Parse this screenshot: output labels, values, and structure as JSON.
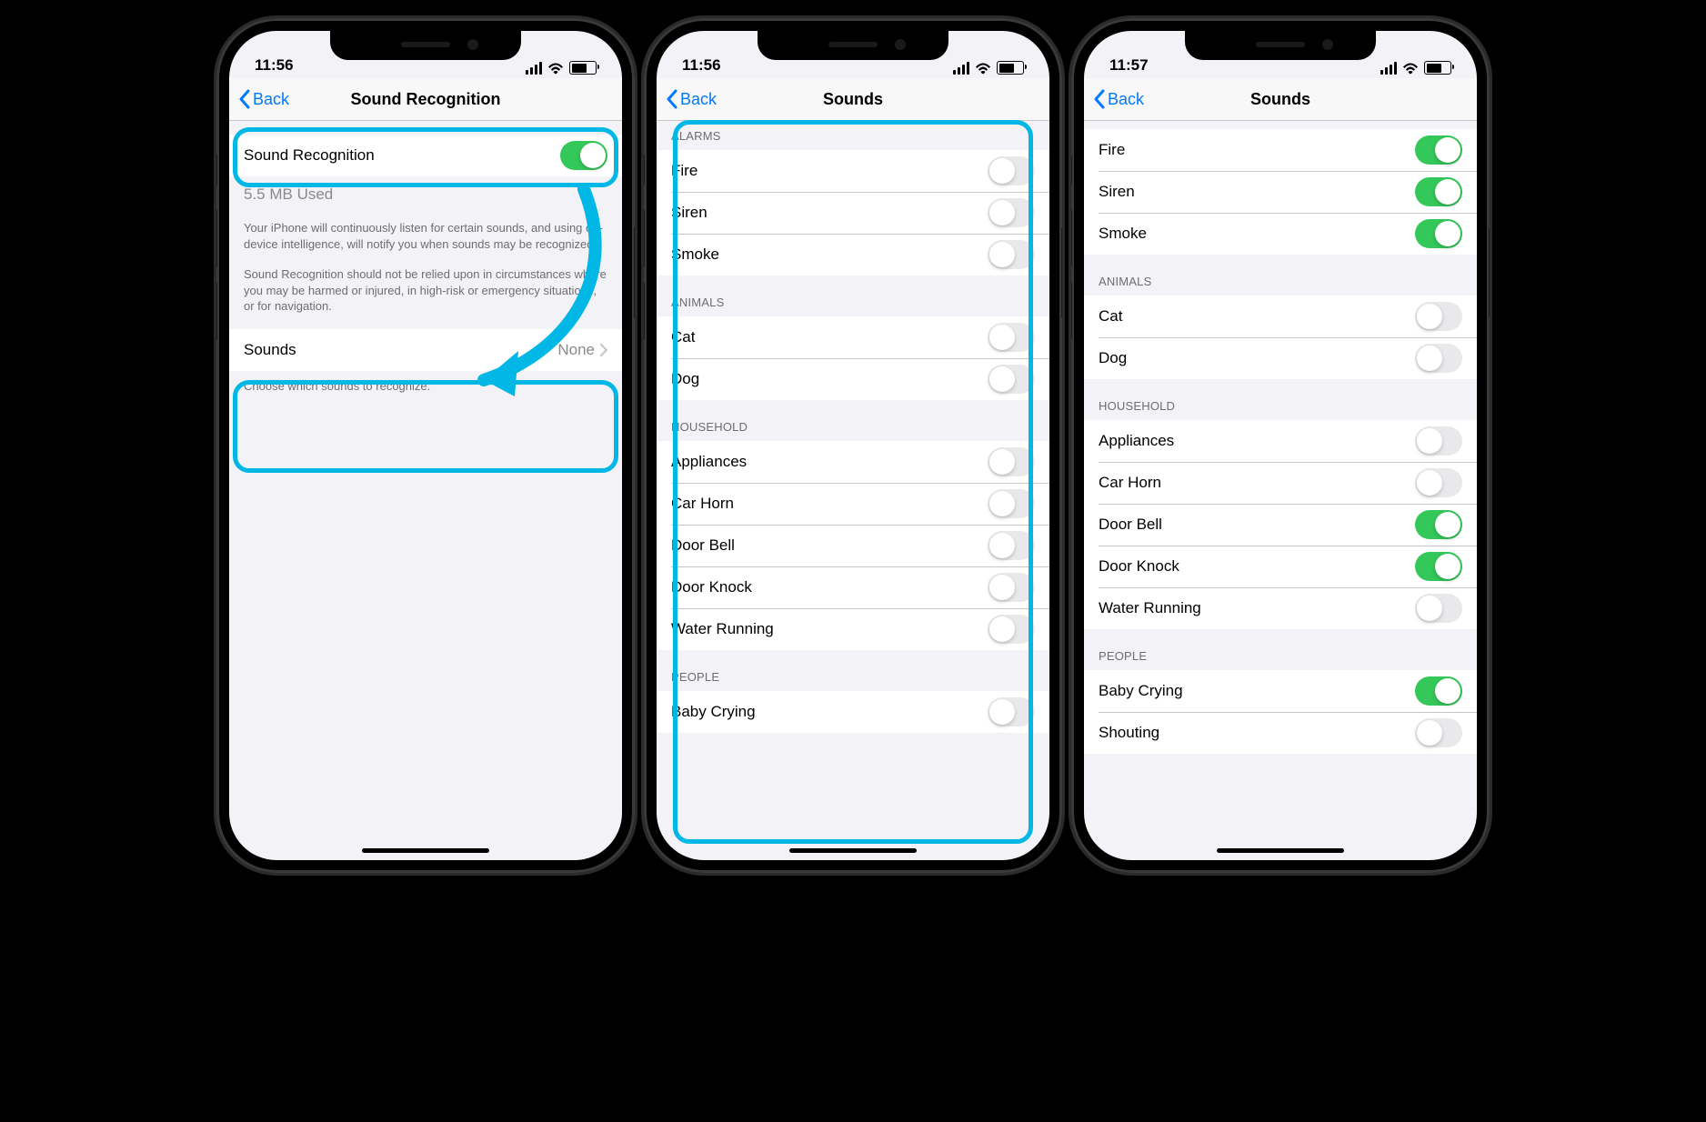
{
  "phones": [
    {
      "time": "11:56",
      "back_label": "Back",
      "nav_title": "Sound Recognition",
      "main_toggle_label": "Sound Recognition",
      "main_toggle_on": true,
      "storage_text": "5.5 MB Used",
      "desc1": "Your iPhone will continuously listen for certain sounds, and using on-device intelligence, will notify you when sounds may be recognized.",
      "desc2": "Sound Recognition should not be relied upon in circumstances where you may be harmed or injured, in high-risk or emergency situations, or for navigation.",
      "sounds_row_label": "Sounds",
      "sounds_row_value": "None",
      "sounds_footer": "Choose which sounds to recognize."
    },
    {
      "time": "11:56",
      "back_label": "Back",
      "nav_title": "Sounds",
      "groups": [
        {
          "header": "ALARMS",
          "items": [
            {
              "label": "Fire",
              "on": false
            },
            {
              "label": "Siren",
              "on": false
            },
            {
              "label": "Smoke",
              "on": false
            }
          ]
        },
        {
          "header": "ANIMALS",
          "items": [
            {
              "label": "Cat",
              "on": false
            },
            {
              "label": "Dog",
              "on": false
            }
          ]
        },
        {
          "header": "HOUSEHOLD",
          "items": [
            {
              "label": "Appliances",
              "on": false
            },
            {
              "label": "Car Horn",
              "on": false
            },
            {
              "label": "Door Bell",
              "on": false
            },
            {
              "label": "Door Knock",
              "on": false
            },
            {
              "label": "Water Running",
              "on": false
            }
          ]
        },
        {
          "header": "PEOPLE",
          "items": [
            {
              "label": "Baby Crying",
              "on": false
            }
          ]
        }
      ]
    },
    {
      "time": "11:57",
      "back_label": "Back",
      "nav_title": "Sounds",
      "scrolled": true,
      "groups": [
        {
          "header": null,
          "items": [
            {
              "label": "Fire",
              "on": true
            },
            {
              "label": "Siren",
              "on": true
            },
            {
              "label": "Smoke",
              "on": true
            }
          ]
        },
        {
          "header": "ANIMALS",
          "items": [
            {
              "label": "Cat",
              "on": false
            },
            {
              "label": "Dog",
              "on": false
            }
          ]
        },
        {
          "header": "HOUSEHOLD",
          "items": [
            {
              "label": "Appliances",
              "on": false
            },
            {
              "label": "Car Horn",
              "on": false
            },
            {
              "label": "Door Bell",
              "on": true
            },
            {
              "label": "Door Knock",
              "on": true
            },
            {
              "label": "Water Running",
              "on": false
            }
          ]
        },
        {
          "header": "PEOPLE",
          "items": [
            {
              "label": "Baby Crying",
              "on": true
            },
            {
              "label": "Shouting",
              "on": false
            }
          ]
        }
      ]
    }
  ]
}
